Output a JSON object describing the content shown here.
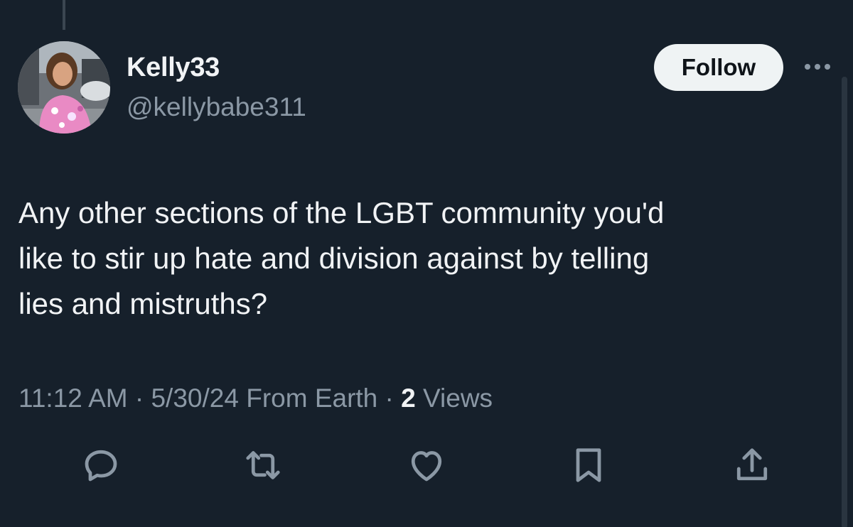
{
  "author": {
    "display_name": "Kelly33",
    "handle": "@kellybabe311"
  },
  "follow_label": "Follow",
  "tweet": {
    "text": "Any other sections of the LGBT community you'd\nlike to stir up hate and division against by telling\nlies and mistruths?"
  },
  "meta": {
    "time": "11:12 AM",
    "separator": "·",
    "date": "5/30/24",
    "location": "From Earth",
    "views_count": "2",
    "views_label": "Views"
  },
  "actions": {
    "icons": [
      "reply-icon",
      "retweet-icon",
      "like-icon",
      "bookmark-icon",
      "share-icon"
    ]
  },
  "colors": {
    "background": "#16202b",
    "primary_text": "#f1f3f5",
    "secondary_text": "#8b98a5",
    "follow_bg": "#eff3f4",
    "follow_text": "#0f1419",
    "icon": "#8b98a5"
  }
}
